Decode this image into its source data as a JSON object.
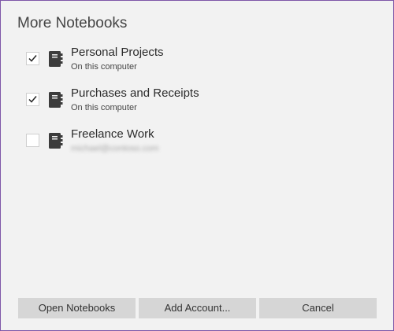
{
  "dialog": {
    "title": "More Notebooks"
  },
  "notebooks": [
    {
      "name": "Personal Projects",
      "location": "On this computer",
      "checked": true,
      "icon": "notebook-icon"
    },
    {
      "name": "Purchases and Receipts",
      "location": "On this computer",
      "checked": true,
      "icon": "notebook-icon"
    },
    {
      "name": "Freelance Work",
      "location": "michael@contoso.com",
      "checked": false,
      "icon": "notebook-icon"
    }
  ],
  "buttons": {
    "open_label": "Open Notebooks",
    "add_account_label": "Add Account...",
    "cancel_label": "Cancel"
  },
  "colors": {
    "border_accent": "#7e57a8",
    "background": "#f2f2f2",
    "button": "#d6d6d6",
    "icon": "#3c3c3c"
  }
}
